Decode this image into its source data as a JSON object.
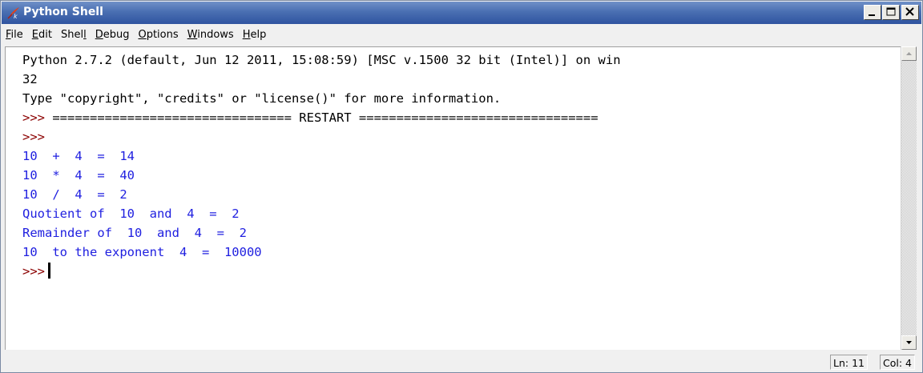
{
  "window": {
    "title": "Python Shell",
    "buttons": {
      "minimize": "minimize-icon",
      "maximize": "maximize-icon",
      "close": "close-icon"
    }
  },
  "menu": [
    "File",
    "Edit",
    "Shell",
    "Debug",
    "Options",
    "Windows",
    "Help"
  ],
  "menu_underline_index": [
    0,
    0,
    4,
    0,
    0,
    0,
    0
  ],
  "shell": {
    "banner_line1": "Python 2.7.2 (default, Jun 12 2011, 15:08:59) [MSC v.1500 32 bit (Intel)] on win",
    "banner_line2": "32",
    "banner_line3": "Type \"copyright\", \"credits\" or \"license()\" for more information.",
    "prompt": ">>>",
    "restart_line": " ================================ RESTART ================================",
    "results": [
      "10  +  4  =  14",
      "10  *  4  =  40",
      "10  /  4  =  2",
      "Quotient of  10  and  4  =  2",
      "Remainder of  10  and  4  =  2",
      "10  to the exponent  4  =  10000"
    ]
  },
  "status": {
    "line": "Ln: 11",
    "col": "Col: 4"
  },
  "colors": {
    "titlebar": "#3a5fa8",
    "output": "#2020e0",
    "prompt": "#8b0000"
  }
}
